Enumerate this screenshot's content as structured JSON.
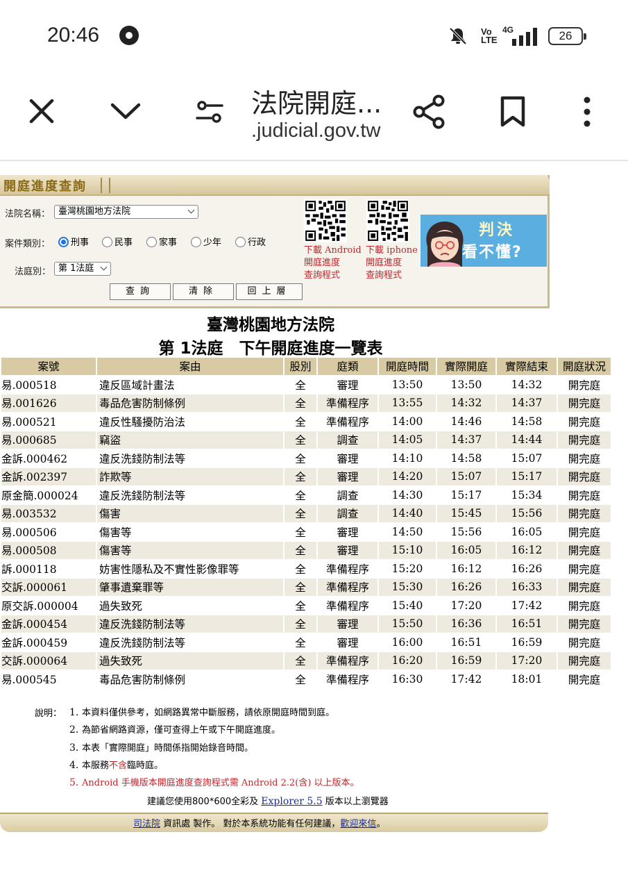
{
  "status_bar": {
    "time": "20:46",
    "volte_top": "Vo",
    "volte_bottom": "LTE",
    "network": "4G",
    "battery": "26"
  },
  "browser": {
    "title": "法院開庭...",
    "url": ".judicial.gov.tw"
  },
  "panel": {
    "tab_label": "開庭進度查詢",
    "court_label": "法院名稱：",
    "court_value": "臺灣桃園地方法院",
    "case_type_label": "案件類別：",
    "case_types": [
      "刑事",
      "民事",
      "家事",
      "少年",
      "行政"
    ],
    "case_type_selected": "刑事",
    "courtroom_label": "法庭別：",
    "courtroom_value": "第 1法庭",
    "buttons": {
      "query": "查詢",
      "clear": "清除",
      "back": "回上層"
    },
    "android_dl": [
      "下載 Android",
      "開庭進度",
      "查詢程式"
    ],
    "iphone_dl": [
      "下載 iphone",
      "開庭進度",
      "查詢程式"
    ],
    "banner_line1": "判決",
    "banner_line2": "看不懂?"
  },
  "court_title": "臺灣桃園地方法院",
  "schedule_title": "第 1法庭　下午開庭進度一覽表",
  "table": {
    "headers": [
      "案號",
      "案由",
      "股別",
      "庭類",
      "開庭時間",
      "實際開庭",
      "實際結束",
      "開庭狀況"
    ],
    "rows": [
      [
        "易.000518",
        "違反區域計畫法",
        "全",
        "審理",
        "13:50",
        "13:50",
        "14:32",
        "開完庭"
      ],
      [
        "易.001626",
        "毒品危害防制條例",
        "全",
        "準備程序",
        "13:55",
        "14:32",
        "14:37",
        "開完庭"
      ],
      [
        "易.000521",
        "違反性騷擾防治法",
        "全",
        "準備程序",
        "14:00",
        "14:46",
        "14:58",
        "開完庭"
      ],
      [
        "易.000685",
        "竊盜",
        "全",
        "調查",
        "14:05",
        "14:37",
        "14:44",
        "開完庭"
      ],
      [
        "金訴.000462",
        "違反洗錢防制法等",
        "全",
        "審理",
        "14:10",
        "14:58",
        "15:07",
        "開完庭"
      ],
      [
        "金訴.002397",
        "詐欺等",
        "全",
        "審理",
        "14:20",
        "15:07",
        "15:17",
        "開完庭"
      ],
      [
        "原金簡.000024",
        "違反洗錢防制法等",
        "全",
        "調查",
        "14:30",
        "15:17",
        "15:34",
        "開完庭"
      ],
      [
        "易.003532",
        "傷害",
        "全",
        "調查",
        "14:40",
        "15:45",
        "15:56",
        "開完庭"
      ],
      [
        "易.000506",
        "傷害等",
        "全",
        "審理",
        "14:50",
        "15:56",
        "16:05",
        "開完庭"
      ],
      [
        "易.000508",
        "傷害等",
        "全",
        "審理",
        "15:10",
        "16:05",
        "16:12",
        "開完庭"
      ],
      [
        "訴.000118",
        "妨害性隱私及不實性影像罪等",
        "全",
        "準備程序",
        "15:20",
        "16:12",
        "16:26",
        "開完庭"
      ],
      [
        "交訴.000061",
        "肇事遺棄罪等",
        "全",
        "準備程序",
        "15:30",
        "16:26",
        "16:33",
        "開完庭"
      ],
      [
        "原交訴.000004",
        "過失致死",
        "全",
        "準備程序",
        "15:40",
        "17:20",
        "17:42",
        "開完庭"
      ],
      [
        "金訴.000454",
        "違反洗錢防制法等",
        "全",
        "審理",
        "15:50",
        "16:36",
        "16:51",
        "開完庭"
      ],
      [
        "金訴.000459",
        "違反洗錢防制法等",
        "全",
        "審理",
        "16:00",
        "16:51",
        "16:59",
        "開完庭"
      ],
      [
        "交訴.000064",
        "過失致死",
        "全",
        "準備程序",
        "16:20",
        "16:59",
        "17:20",
        "開完庭"
      ],
      [
        "易.000545",
        "毒品危害防制條例",
        "全",
        "準備程序",
        "16:30",
        "17:42",
        "18:01",
        "開完庭"
      ]
    ]
  },
  "notes": {
    "label": "說明：",
    "items": [
      {
        "num": "1.",
        "text": "本資料僅供參考，如網路異常中斷服務，請依原開庭時間到庭。"
      },
      {
        "num": "2.",
        "text": "為節省網路資源，僅可查得上午或下午開庭進度。"
      },
      {
        "num": "3.",
        "text": "本表「實際開庭」時間係指開始錄音時間。"
      },
      {
        "num": "4.",
        "pre": "本服務",
        "red": "不含",
        "post": "臨時庭。"
      },
      {
        "num": "5.",
        "text": "Android 手機版本開庭進度查詢程式需 Android 2.2(含) 以上版本。"
      }
    ],
    "browser_pre": "建議您使用800*600全彩及 ",
    "browser_link": "Explorer 5.5",
    "browser_post": " 版本以上瀏覽器"
  },
  "footer": {
    "link1": "司法院",
    "text": " 資訊處 製作。 對於本系統功能有任何建議，",
    "link2": "歡迎來信",
    "end": "。"
  }
}
